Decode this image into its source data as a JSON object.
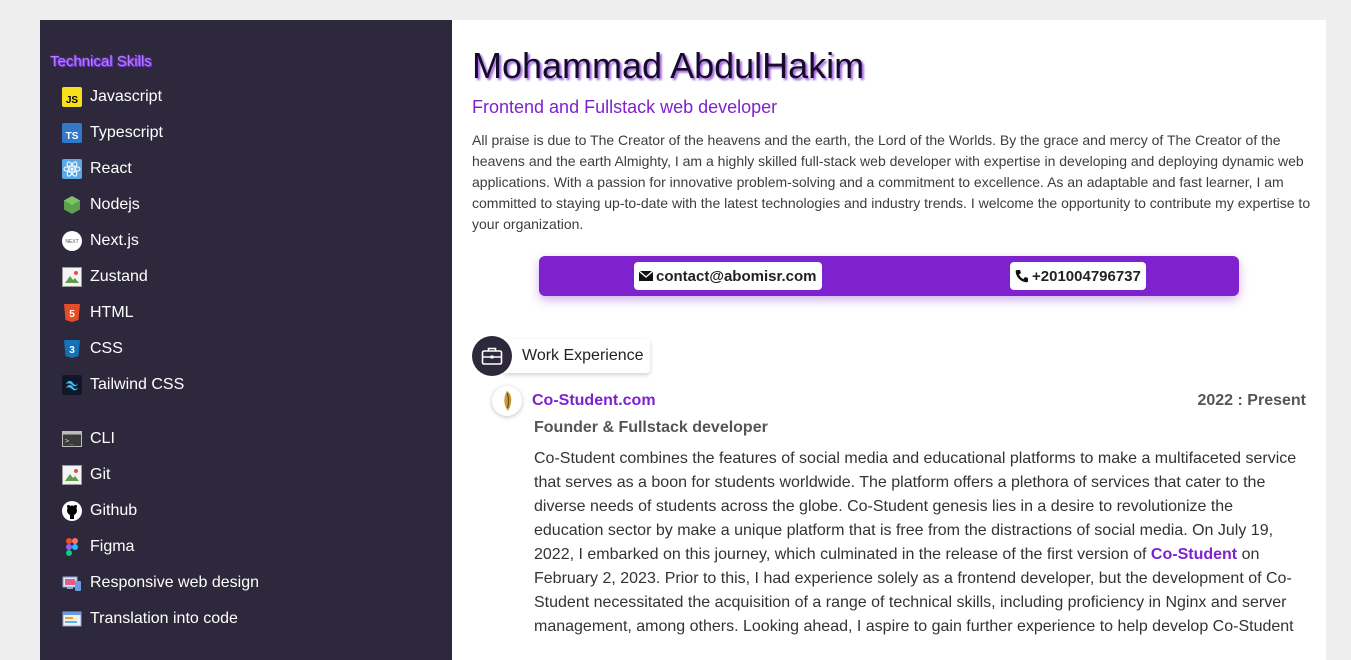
{
  "sidebar": {
    "heading": "Technical Skills",
    "skills_group_1": [
      {
        "label": "Javascript",
        "icon": "javascript-icon"
      },
      {
        "label": "Typescript",
        "icon": "typescript-icon"
      },
      {
        "label": "React",
        "icon": "react-icon"
      },
      {
        "label": "Nodejs",
        "icon": "nodejs-icon"
      },
      {
        "label": "Next.js",
        "icon": "nextjs-icon"
      },
      {
        "label": "Zustand",
        "icon": "broken-image-icon"
      },
      {
        "label": "HTML",
        "icon": "html5-icon"
      },
      {
        "label": "CSS",
        "icon": "css3-icon"
      },
      {
        "label": "Tailwind CSS",
        "icon": "tailwind-icon"
      }
    ],
    "skills_group_2": [
      {
        "label": "CLI",
        "icon": "terminal-icon"
      },
      {
        "label": "Git",
        "icon": "broken-image-icon"
      },
      {
        "label": "Github",
        "icon": "github-icon"
      },
      {
        "label": "Figma",
        "icon": "figma-icon"
      },
      {
        "label": "Responsive web design",
        "icon": "responsive-devices-icon"
      },
      {
        "label": "Translation into code",
        "icon": "code-translation-icon"
      }
    ]
  },
  "header": {
    "name": "Mohammad AbdulHakim",
    "subtitle": "Frontend and Fullstack web developer",
    "about": "All praise is due to The Creator of the heavens and the earth, the Lord of the Worlds. By the grace and mercy of The Creator of the heavens and the earth Almighty, I am a highly skilled full-stack web developer with expertise in developing and deploying dynamic web applications. With a passion for innovative problem-solving and a commitment to excellence. As an adaptable and fast learner, I am committed to staying up-to-date with the latest technologies and industry trends. I welcome the opportunity to contribute my expertise to your organization."
  },
  "contact": {
    "email": "contact@abomisr.com",
    "phone": "+201004796737"
  },
  "experience": {
    "section_label": "Work Experience",
    "jobs": [
      {
        "company": "Co-Student.com",
        "period": "2022 : Present",
        "role": "Founder & Fullstack developer",
        "desc_before_link": "Co-Student combines the features of social media and educational platforms to make a multifaceted service that serves as a boon for students worldwide. The platform offers a plethora of services that cater to the diverse needs of students across the globe. Co-Student genesis lies in a desire to revolutionize the education sector by make a unique platform that is free from the distractions of social media. On July 19, 2022, I embarked on this journey, which culminated in the release of the first version of ",
        "desc_link": "Co-Student",
        "desc_after_link": " on February 2, 2023. Prior to this, I had experience solely as a frontend developer, but the development of Co-Student necessitated the acquisition of a range of technical skills, including proficiency in Nginx and server management, among others. Looking ahead, I aspire to gain further experience to help develop Co-Student"
      }
    ]
  },
  "colors": {
    "sidebar_bg": "#2d283b",
    "accent": "#7e22ce",
    "page_bg": "#eeeeee"
  }
}
